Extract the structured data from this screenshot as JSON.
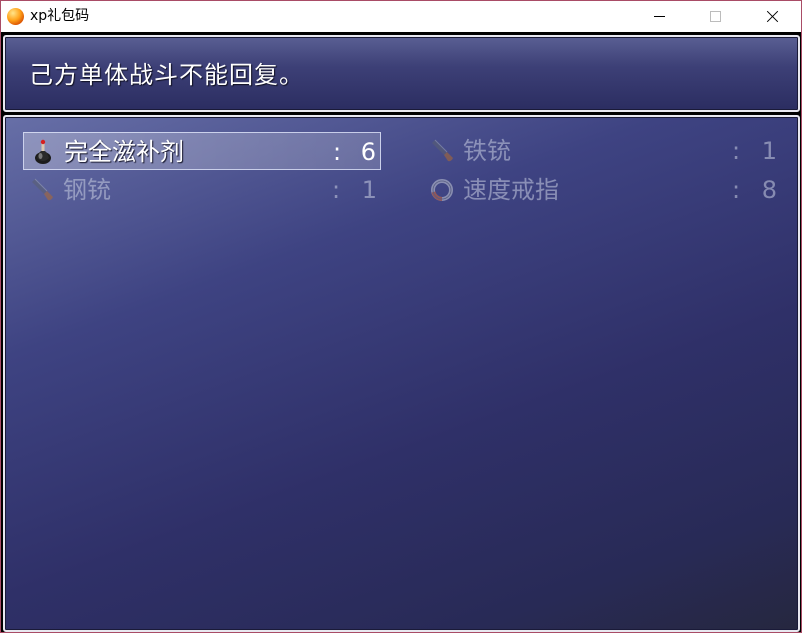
{
  "window": {
    "title": "xp礼包码",
    "controls": [
      "minimize",
      "maximize",
      "close"
    ]
  },
  "help": {
    "text": "己方单体战斗不能回复。"
  },
  "items": [
    {
      "name": "完全滋补剂",
      "colon": ":",
      "quantity": "6",
      "icon": "potion-bottle-icon",
      "selected": true,
      "enabled": true
    },
    {
      "name": "铁铳",
      "colon": ":",
      "quantity": "1",
      "icon": "gun-icon",
      "selected": false,
      "enabled": false
    },
    {
      "name": "钢铳",
      "colon": ":",
      "quantity": "1",
      "icon": "gun-icon",
      "selected": false,
      "enabled": false
    },
    {
      "name": "速度戒指",
      "colon": ":",
      "quantity": "8",
      "icon": "ring-icon",
      "selected": false,
      "enabled": false
    }
  ],
  "colors": {
    "panel_top": "#676fa7",
    "panel_bottom": "#26273f",
    "border": "#e8e8f0",
    "text": "#ffffff",
    "disabled_text": "#c8cde1",
    "window_border": "#a94c66"
  }
}
